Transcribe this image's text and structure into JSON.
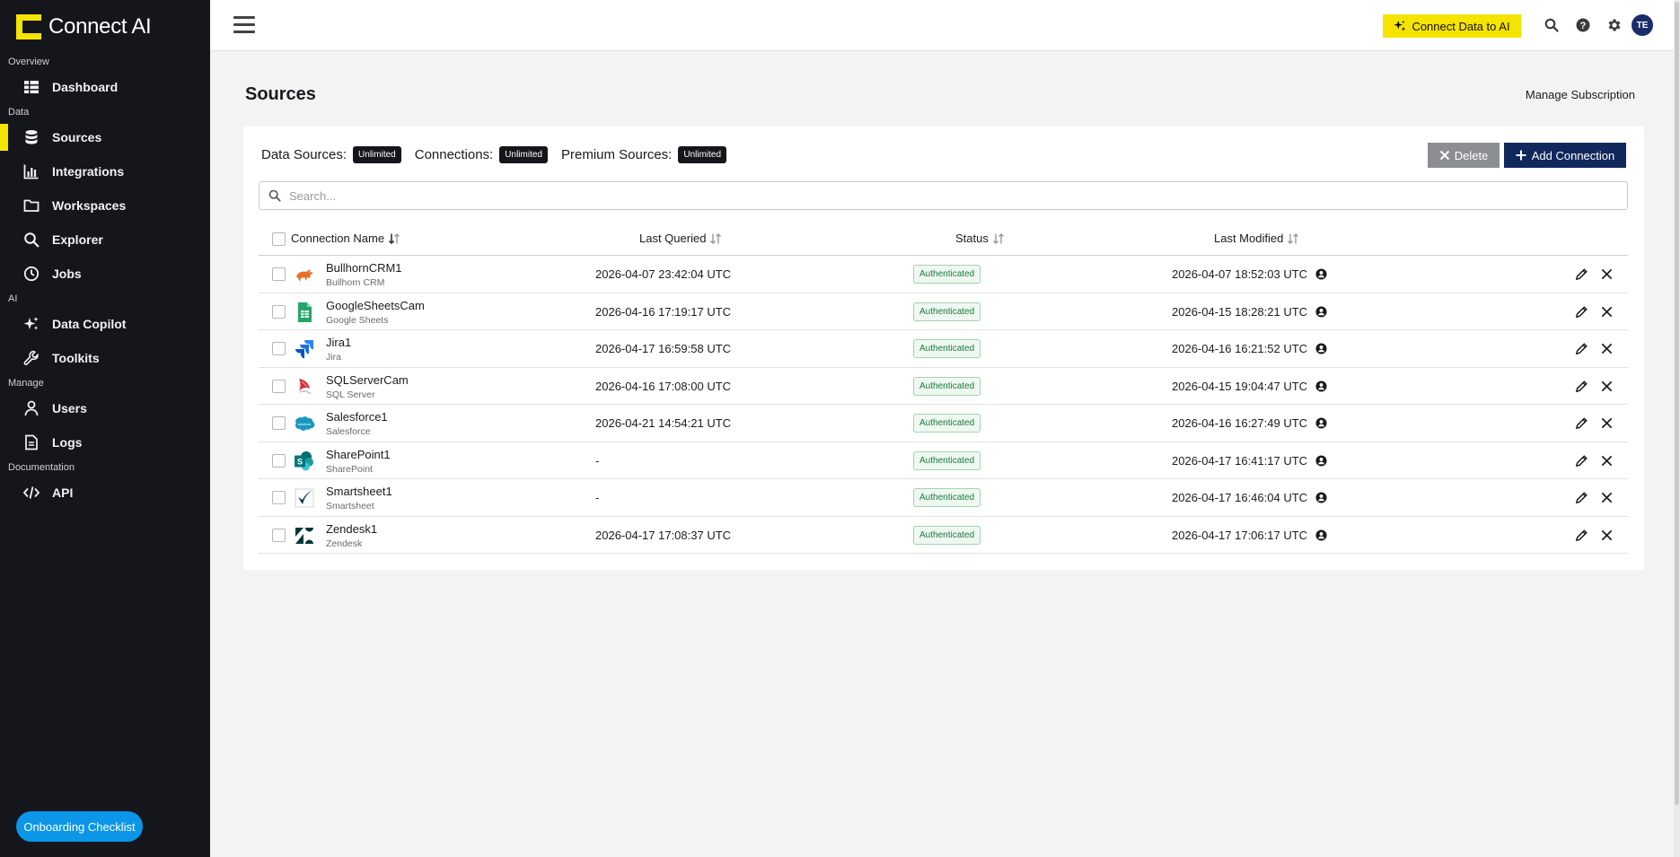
{
  "brand": {
    "name": "Connect AI"
  },
  "sidebar": {
    "sections": [
      {
        "title": "Overview",
        "items": [
          {
            "label": "Dashboard",
            "icon": "dashboard-icon"
          }
        ]
      },
      {
        "title": "Data",
        "items": [
          {
            "label": "Sources",
            "icon": "database-icon",
            "active": true
          },
          {
            "label": "Integrations",
            "icon": "bar-chart-icon"
          },
          {
            "label": "Workspaces",
            "icon": "folder-icon"
          },
          {
            "label": "Explorer",
            "icon": "search-icon"
          },
          {
            "label": "Jobs",
            "icon": "clock-icon"
          }
        ]
      },
      {
        "title": "AI",
        "items": [
          {
            "label": "Data Copilot",
            "icon": "sparkle-icon"
          },
          {
            "label": "Toolkits",
            "icon": "wrench-icon"
          }
        ]
      },
      {
        "title": "Manage",
        "items": [
          {
            "label": "Users",
            "icon": "user-icon"
          },
          {
            "label": "Logs",
            "icon": "document-icon"
          }
        ]
      },
      {
        "title": "Documentation",
        "items": [
          {
            "label": "API",
            "icon": "code-icon"
          }
        ]
      }
    ],
    "onboarding_label": "Onboarding Checklist"
  },
  "topbar": {
    "connect_ai_label": "Connect Data to AI",
    "avatar_initials": "TE"
  },
  "page": {
    "title": "Sources",
    "manage_subscription": "Manage Subscription"
  },
  "limits": {
    "data_sources_label": "Data Sources:",
    "data_sources_value": "Unlimited",
    "connections_label": "Connections:",
    "connections_value": "Unlimited",
    "premium_label": "Premium Sources:",
    "premium_value": "Unlimited"
  },
  "actions": {
    "delete_label": "Delete",
    "add_label": "Add Connection"
  },
  "search": {
    "placeholder": "Search..."
  },
  "table": {
    "columns": [
      "Connection Name",
      "Last Queried",
      "Status",
      "Last Modified"
    ],
    "rows": [
      {
        "name": "BullhornCRM1",
        "driver": "Bullhorn CRM",
        "last_queried": "2026-04-07 23:42:04 UTC",
        "status": "Authenticated",
        "last_modified": "2026-04-07 18:52:03 UTC",
        "logo": "bullhorn-logo"
      },
      {
        "name": "GoogleSheetsCam",
        "driver": "Google Sheets",
        "last_queried": "2026-04-16 17:19:17 UTC",
        "status": "Authenticated",
        "last_modified": "2026-04-15 18:28:21 UTC",
        "logo": "google-sheets-logo"
      },
      {
        "name": "Jira1",
        "driver": "Jira",
        "last_queried": "2026-04-17 16:59:58 UTC",
        "status": "Authenticated",
        "last_modified": "2026-04-16 16:21:52 UTC",
        "logo": "jira-logo"
      },
      {
        "name": "SQLServerCam",
        "driver": "SQL Server",
        "last_queried": "2026-04-16 17:08:00 UTC",
        "status": "Authenticated",
        "last_modified": "2026-04-15 19:04:47 UTC",
        "logo": "sql-server-logo"
      },
      {
        "name": "Salesforce1",
        "driver": "Salesforce",
        "last_queried": "2026-04-21 14:54:21 UTC",
        "status": "Authenticated",
        "last_modified": "2026-04-16 16:27:49 UTC",
        "logo": "salesforce-logo"
      },
      {
        "name": "SharePoint1",
        "driver": "SharePoint",
        "last_queried": "-",
        "status": "Authenticated",
        "last_modified": "2026-04-17 16:41:17 UTC",
        "logo": "sharepoint-logo"
      },
      {
        "name": "Smartsheet1",
        "driver": "Smartsheet",
        "last_queried": "-",
        "status": "Authenticated",
        "last_modified": "2026-04-17 16:46:04 UTC",
        "logo": "smartsheet-logo"
      },
      {
        "name": "Zendesk1",
        "driver": "Zendesk",
        "last_queried": "2026-04-17 17:08:37 UTC",
        "status": "Authenticated",
        "last_modified": "2026-04-17 17:06:17 UTC",
        "logo": "zendesk-logo"
      }
    ]
  },
  "colors": {
    "sidebar_bg": "#15161b",
    "accent_yellow": "#f5e400",
    "primary_navy": "#10285c",
    "status_green": "#1b7a3a"
  }
}
